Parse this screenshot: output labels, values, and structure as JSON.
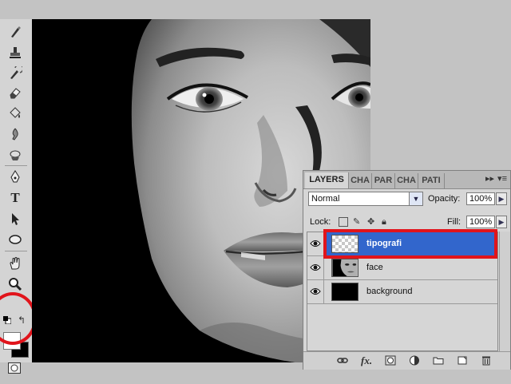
{
  "tools": [
    {
      "name": "brush-icon",
      "glyph": "✎"
    },
    {
      "name": "clone-stamp-icon",
      "glyph": "⊥"
    },
    {
      "name": "history-brush-icon",
      "glyph": "✐"
    },
    {
      "name": "eraser-icon",
      "glyph": "◩"
    },
    {
      "name": "paint-bucket-icon",
      "glyph": "◆"
    },
    {
      "name": "blur-icon",
      "glyph": "♦"
    },
    {
      "name": "dodge-icon",
      "glyph": "◎"
    },
    {
      "name": "pen-icon",
      "glyph": "✒"
    },
    {
      "name": "type-icon",
      "glyph": "T"
    },
    {
      "name": "path-selection-icon",
      "glyph": "➤"
    },
    {
      "name": "ellipse-icon",
      "glyph": "⬭"
    },
    {
      "name": "hand-icon",
      "glyph": "✋"
    },
    {
      "name": "zoom-icon",
      "glyph": "⚲"
    }
  ],
  "colors": {
    "foreground": "#ffffff",
    "background": "#000000",
    "highlight": "#e1141b",
    "selection": "#3266cc"
  },
  "layers_panel": {
    "tabs": [
      {
        "label": "LAYERS",
        "active": true
      },
      {
        "label": "CHA",
        "active": false
      },
      {
        "label": "PAR",
        "active": false
      },
      {
        "label": "CHA",
        "active": false
      },
      {
        "label": "PATI",
        "active": false
      }
    ],
    "collapse_glyph": "▸▸",
    "menu_glyph": "▾≡",
    "blend_mode": "Normal",
    "opacity_label": "Opacity:",
    "opacity_value": "100%",
    "lock_label": "Lock:",
    "fill_label": "Fill:",
    "fill_value": "100%",
    "layers": [
      {
        "name": "tipografi",
        "thumb": "checker",
        "selected": true
      },
      {
        "name": "face",
        "thumb": "face",
        "selected": false
      },
      {
        "name": "background",
        "thumb": "black",
        "selected": false
      }
    ],
    "footer_icons": [
      "link-icon",
      "fx-icon",
      "mask-icon",
      "adjustment-icon",
      "group-folder-icon",
      "new-layer-icon",
      "trash-icon"
    ],
    "fx_label": "fx."
  }
}
